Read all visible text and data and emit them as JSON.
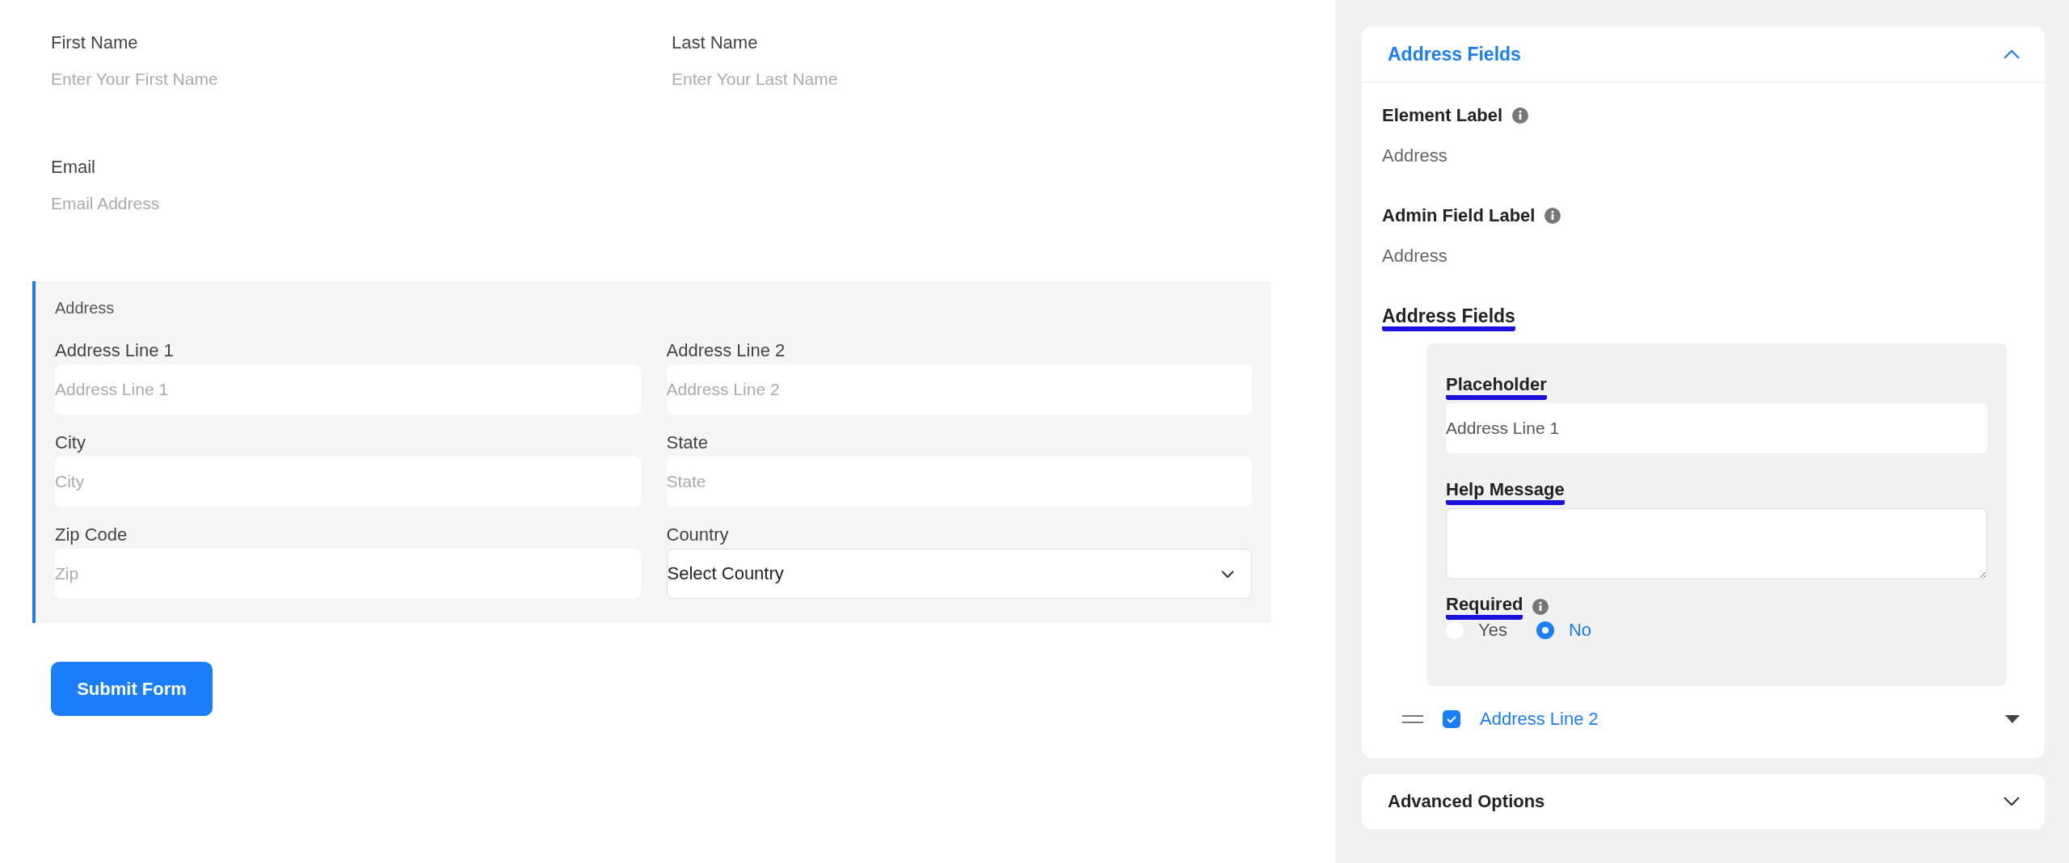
{
  "form": {
    "rows": [
      [
        {
          "label": "First Name",
          "placeholder": "Enter Your First Name"
        },
        {
          "label": "Last Name",
          "placeholder": "Enter Your Last Name"
        }
      ],
      [
        {
          "label": "Email",
          "placeholder": "Email Address"
        }
      ]
    ],
    "address": {
      "title": "Address",
      "fields": [
        {
          "label": "Address Line 1",
          "placeholder": "Address Line 1",
          "kind": "input"
        },
        {
          "label": "Address Line 2",
          "placeholder": "Address Line 2",
          "kind": "input"
        },
        {
          "label": "City",
          "placeholder": "City",
          "kind": "input"
        },
        {
          "label": "State",
          "placeholder": "State",
          "kind": "input"
        },
        {
          "label": "Zip Code",
          "placeholder": "Zip",
          "kind": "input"
        },
        {
          "label": "Country",
          "value": "Select Country",
          "kind": "select"
        }
      ]
    },
    "submit": "Submit Form"
  },
  "sidebar": {
    "panel": {
      "title": "Address Fields",
      "expanded": true,
      "settings": [
        {
          "label": "Element Label",
          "info": true,
          "value": "Address",
          "underlined": false
        },
        {
          "label": "Admin Field Label",
          "info": true,
          "value": "Address",
          "underlined": false
        }
      ],
      "section_title": {
        "text": "Address Fields",
        "underlined": true
      },
      "subfield": {
        "placeholder_label": {
          "text": "Placeholder",
          "underlined": true
        },
        "placeholder_input": {
          "value": "Address Line 1"
        },
        "help_label": {
          "text": "Help Message",
          "underlined": true
        },
        "required_label": {
          "text": "Required",
          "underlined": true
        },
        "required_options": [
          {
            "label": "Yes",
            "selected": false
          },
          {
            "label": "No",
            "selected": true
          }
        ]
      },
      "next_item": {
        "label": "Address Line 2",
        "checked": true
      }
    },
    "advanced": {
      "title": "Advanced Options",
      "expanded": false
    }
  }
}
